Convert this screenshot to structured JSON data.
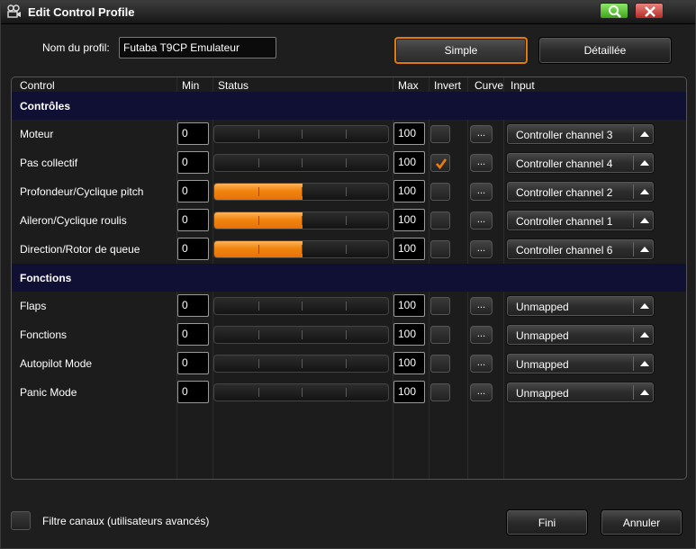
{
  "window": {
    "title": "Edit Control Profile"
  },
  "icons": {
    "app": "film-camera-icon",
    "search": "magnifier-icon",
    "close": "close-x-icon"
  },
  "colors": {
    "accent": "#e07a10",
    "section_bg": "#101034",
    "fill": "#f0850e",
    "check": "#f07d0a"
  },
  "profile": {
    "label": "Nom du profil:",
    "value": "Futaba T9CP Emulateur"
  },
  "tabs": {
    "simple": "Simple",
    "detailed": "Détaillée",
    "active": "Simple"
  },
  "table": {
    "headers": {
      "control": "Control",
      "min": "Min",
      "status": "Status",
      "max": "Max",
      "invert": "Invert",
      "curve": "Curve",
      "input": "Input"
    },
    "sections": [
      {
        "title": "Contrôles",
        "rows": [
          {
            "name": "Moteur",
            "min": "0",
            "max": "100",
            "invert": false,
            "curve": "...",
            "input": "Controller channel 3",
            "status": 0
          },
          {
            "name": "Pas collectif",
            "min": "0",
            "max": "100",
            "invert": true,
            "curve": "...",
            "input": "Controller channel 4",
            "status": 0
          },
          {
            "name": "Profondeur/Cyclique pitch",
            "min": "0",
            "max": "100",
            "invert": false,
            "curve": "...",
            "input": "Controller channel 2",
            "status": 0.5
          },
          {
            "name": "Aileron/Cyclique roulis",
            "min": "0",
            "max": "100",
            "invert": false,
            "curve": "...",
            "input": "Controller channel 1",
            "status": 0.5
          },
          {
            "name": "Direction/Rotor de queue",
            "min": "0",
            "max": "100",
            "invert": false,
            "curve": "...",
            "input": "Controller channel 6",
            "status": 0.5
          }
        ]
      },
      {
        "title": "Fonctions",
        "rows": [
          {
            "name": "Flaps",
            "min": "0",
            "max": "100",
            "invert": false,
            "curve": "...",
            "input": "Unmapped",
            "status": 0
          },
          {
            "name": "Fonctions",
            "min": "0",
            "max": "100",
            "invert": false,
            "curve": "...",
            "input": "Unmapped",
            "status": 0
          },
          {
            "name": "Autopilot Mode",
            "min": "0",
            "max": "100",
            "invert": false,
            "curve": "...",
            "input": "Unmapped",
            "status": 0
          },
          {
            "name": "Panic Mode",
            "min": "0",
            "max": "100",
            "invert": false,
            "curve": "...",
            "input": "Unmapped",
            "status": 0
          }
        ]
      }
    ]
  },
  "footer": {
    "filter_label": "Filtre canaux (utilisateurs avancés)",
    "filter_checked": false,
    "ok": "Fini",
    "cancel": "Annuler"
  }
}
